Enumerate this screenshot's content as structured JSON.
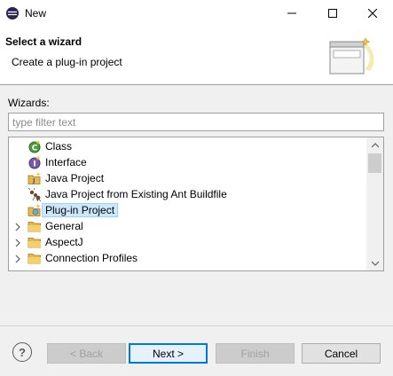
{
  "window": {
    "title": "New"
  },
  "header": {
    "title": "Select a wizard",
    "description": "Create a plug-in project"
  },
  "filter": {
    "label": "Wizards:",
    "placeholder": "type filter text",
    "value": ""
  },
  "tree": {
    "items": [
      {
        "label": "Class",
        "icon": "java-class-icon",
        "expandable": false,
        "selected": false
      },
      {
        "label": "Interface",
        "icon": "java-interface-icon",
        "expandable": false,
        "selected": false
      },
      {
        "label": "Java Project",
        "icon": "java-project-icon",
        "expandable": false,
        "selected": false
      },
      {
        "label": "Java Project from Existing Ant Buildfile",
        "icon": "ant-icon",
        "expandable": false,
        "selected": false
      },
      {
        "label": "Plug-in Project",
        "icon": "plugin-project-icon",
        "expandable": false,
        "selected": true
      },
      {
        "label": "General",
        "icon": "folder-icon",
        "expandable": true,
        "selected": false
      },
      {
        "label": "AspectJ",
        "icon": "folder-icon",
        "expandable": true,
        "selected": false
      },
      {
        "label": "Connection Profiles",
        "icon": "folder-icon",
        "expandable": true,
        "selected": false
      }
    ]
  },
  "buttons": {
    "back": "< Back",
    "next": "Next >",
    "finish": "Finish",
    "cancel": "Cancel",
    "help": "?"
  },
  "colors": {
    "selection": "#cce8ff",
    "default_button_border": "#0078d7",
    "folder": "#e8b84a"
  }
}
